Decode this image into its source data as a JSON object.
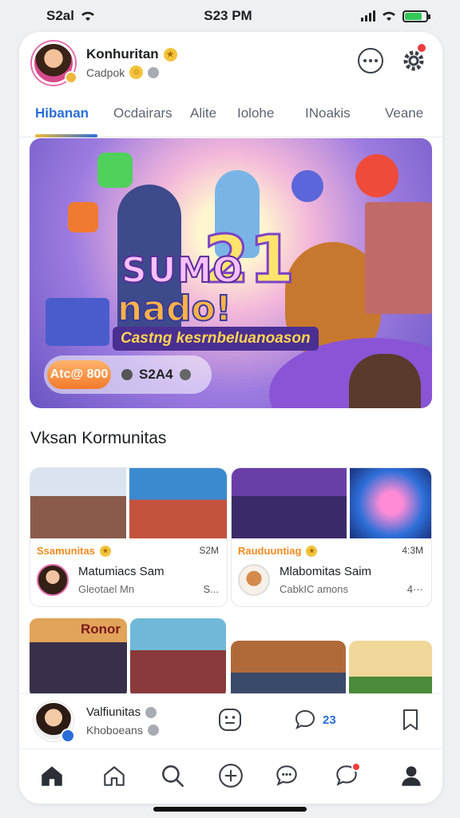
{
  "status": {
    "left": "S2al",
    "time": "S23 PM"
  },
  "header": {
    "name": "Konhuritan",
    "sub": "Cadpok"
  },
  "tabs": [
    "Hibanan",
    "Ocdairars",
    "Alite",
    "Iolohe",
    "INoakis",
    "Veane"
  ],
  "hero": {
    "title_line1": "SUMO",
    "title_number": "21",
    "title_line2": "nado!",
    "subtitle": "Castng kesrnbeluanoason",
    "price_pill": "Atc@ 800",
    "count": "S2A4"
  },
  "section_title": "Vksan Kormunitas",
  "communities": [
    {
      "label": "Ssamunitas",
      "meta": "S2M",
      "name": "Matumiacs Sam",
      "desc": "Gleotael Mn",
      "more": "S..."
    },
    {
      "label": "Rauduuntiag",
      "meta": "4:3M",
      "name": "Mlabomitas Saim",
      "desc": "CabkIC amons",
      "more": "4···"
    }
  ],
  "row2_sign": "Ronor",
  "player": {
    "name": "Valfiunitas",
    "sub": "Khoboeans",
    "count": "23"
  },
  "nav": [
    "home-icon",
    "house-outline-icon",
    "search-icon",
    "add-icon",
    "chat-icon",
    "message-icon",
    "profile-icon"
  ],
  "colors": {
    "accent": "#2a6dd8",
    "orange": "#f08a1e",
    "badge_red": "#ef3b3b"
  }
}
